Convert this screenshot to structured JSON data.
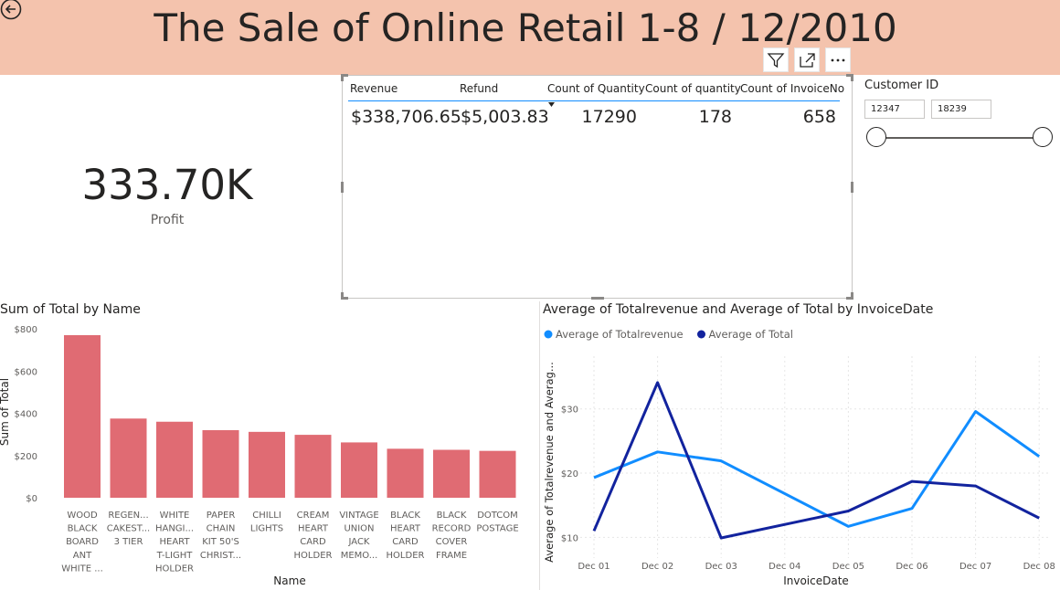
{
  "header": {
    "title": "The Sale of Online Retail 1-8 / 12/2010",
    "back_icon": "back-arrow-icon",
    "buttons": [
      "filter-icon",
      "focus-mode-icon",
      "more-options-icon"
    ]
  },
  "kpi": {
    "value": "333.70K",
    "label": "Profit"
  },
  "table": {
    "columns": [
      "Revenue",
      "Refund",
      "Count of Quantity",
      "Count of quantity",
      "Count of InvoiceNo"
    ],
    "row": [
      "$338,706.65",
      "$5,003.83",
      "17290",
      "178",
      "658"
    ]
  },
  "slicer": {
    "title": "Customer ID",
    "min_value": "12347",
    "max_value": "18239"
  },
  "colors": {
    "header_bg": "#f4c3ad",
    "bar": "#e06b73",
    "series_light": "#118dff",
    "series_dark": "#12239e"
  },
  "chart_data": [
    {
      "type": "bar",
      "title": "Sum of Total by Name",
      "xlabel": "Name",
      "ylabel": "Sum of Total",
      "categories": [
        [
          "WOOD",
          "BLACK",
          "BOARD",
          "ANT",
          "WHITE ..."
        ],
        [
          "REGEN...",
          "CAKEST...",
          "3 TIER"
        ],
        [
          "WHITE",
          "HANGI...",
          "HEART",
          "T-LIGHT",
          "HOLDER"
        ],
        [
          "PAPER",
          "CHAIN",
          "KIT 50'S",
          "CHRIST..."
        ],
        [
          "CHILLI",
          "LIGHTS"
        ],
        [
          "CREAM",
          "HEART",
          "CARD",
          "HOLDER"
        ],
        [
          "VINTAGE",
          "UNION",
          "JACK",
          "MEMO..."
        ],
        [
          "BLACK",
          "HEART",
          "CARD",
          "HOLDER"
        ],
        [
          "BLACK",
          "RECORD",
          "COVER",
          "FRAME"
        ],
        [
          "DOTCOM",
          "POSTAGE"
        ]
      ],
      "values": [
        770,
        375,
        360,
        320,
        312,
        298,
        262,
        232,
        227,
        222
      ],
      "yticks": [
        "$0",
        "$200",
        "$400",
        "$600",
        "$800"
      ],
      "ylim": [
        0,
        800
      ]
    },
    {
      "type": "line",
      "title": "Average of Totalrevenue and Average of Total by InvoiceDate",
      "xlabel": "InvoiceDate",
      "ylabel": "Average of Totalrevenue and Averag...",
      "x": [
        "Dec 01",
        "Dec 02",
        "Dec 03",
        "Dec 04",
        "Dec 05",
        "Dec 06",
        "Dec 07",
        "Dec 08"
      ],
      "yticks": [
        "$10",
        "$20",
        "$30"
      ],
      "ylim": [
        7.2,
        37.5
      ],
      "legend": "top-left",
      "series": [
        {
          "name": "Average of Totalrevenue",
          "values": [
            19.3,
            23.3,
            21.9,
            null,
            11.7,
            14.5,
            29.6,
            22.6
          ]
        },
        {
          "name": "Average of Total",
          "values": [
            11.0,
            34.1,
            9.9,
            null,
            14.1,
            18.7,
            18.0,
            13.0
          ]
        }
      ]
    }
  ]
}
